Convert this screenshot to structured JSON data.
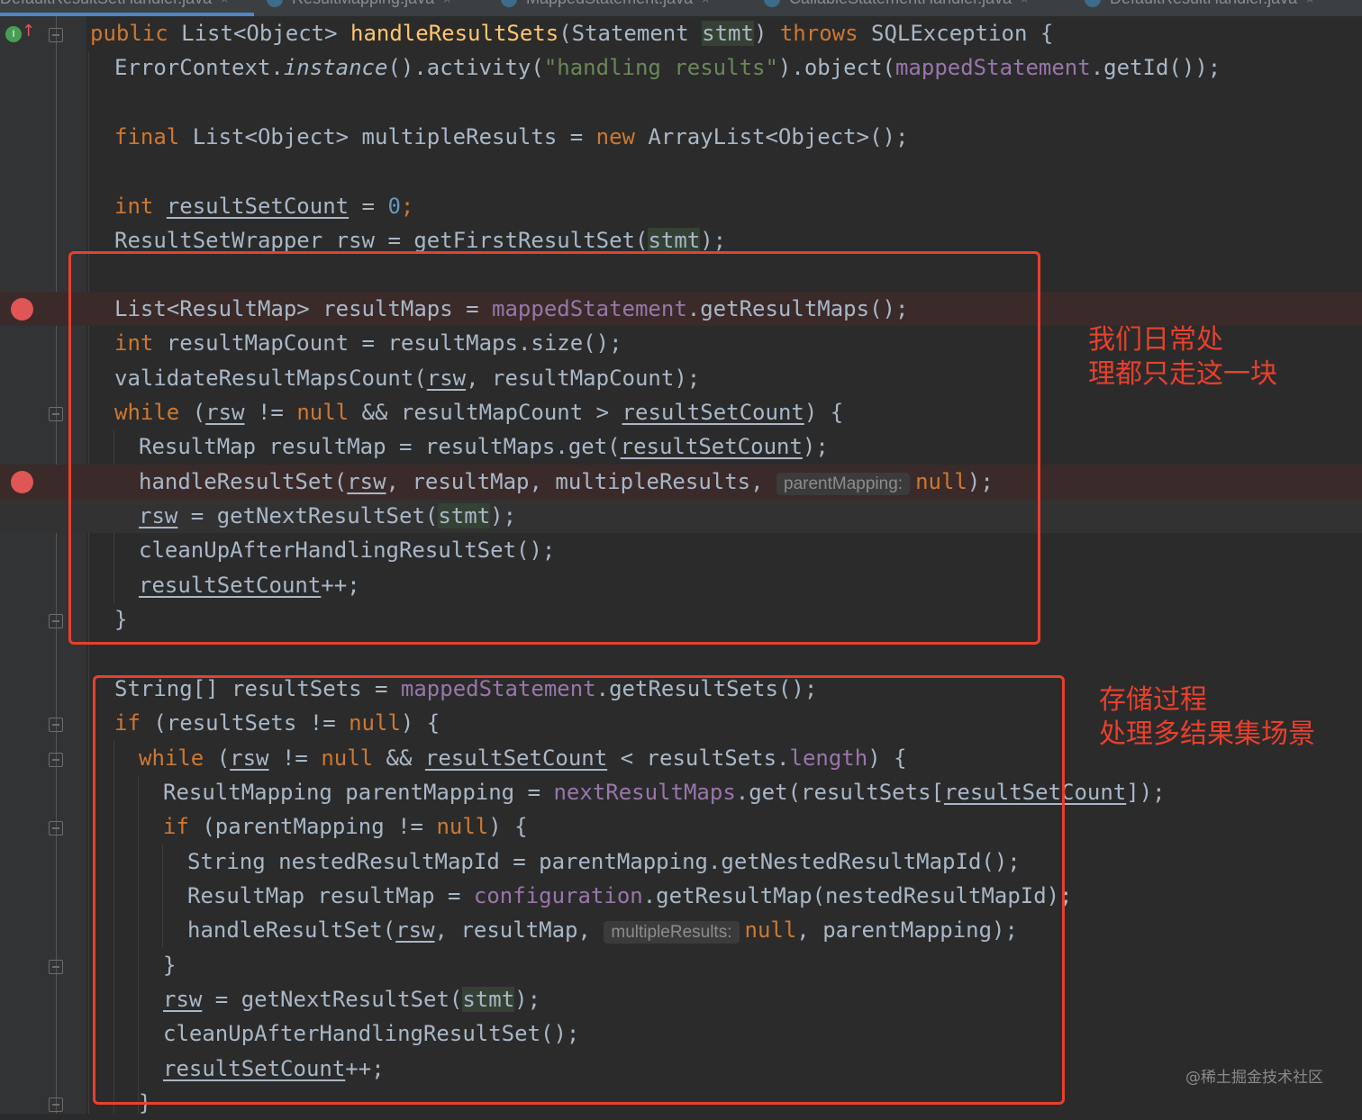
{
  "tabs": [
    {
      "label": "DefaultResultSetHandler.java",
      "close": "×"
    },
    {
      "label": "ResultMapping.java",
      "close": "×"
    },
    {
      "label": "MappedStatement.java",
      "close": "×"
    },
    {
      "label": "CallableStatementHandler.java",
      "close": "×"
    },
    {
      "label": "DefaultResultHandler.java",
      "close": "×"
    }
  ],
  "gutter": {
    "implements_icon": "override-up-arrow-icon",
    "breakpoint_color": "#e05555"
  },
  "colors": {
    "keyword": "#cc7832",
    "function": "#ffc66d",
    "string": "#6a8759",
    "number": "#6897bb",
    "field": "#9876aa",
    "text": "#a9b7c6",
    "annotation_red": "#e8402c"
  },
  "code": {
    "l1": {
      "a": "public",
      "b": " List<Object> ",
      "c": "handleResultSets",
      "d": "(Statement ",
      "e": "stmt",
      "f": ") ",
      "g": "throws",
      "h": " SQLException {"
    },
    "l2": {
      "a": "ErrorContext.",
      "b": "instance",
      "c": "().activity(",
      "d": "\"handling results\"",
      "e": ").object(",
      "f": "mappedStatement",
      "g": ".getId());"
    },
    "l4": {
      "a": "final",
      "b": " List<Object> multipleResults = ",
      "c": "new",
      "d": " ArrayList<Object>();"
    },
    "l6": {
      "a": "int",
      "b": " ",
      "c": "resultSetCount",
      "d": " = ",
      "e": "0",
      "f": ";"
    },
    "l7": {
      "a": "ResultSetWrapper ",
      "b": "rsw",
      "c": " = getFirstResultSet(",
      "d": "stmt",
      "e": ");"
    },
    "l9": {
      "a": "List<ResultMap> resultMaps = ",
      "b": "mappedStatement",
      "c": ".getResultMaps();"
    },
    "l10": {
      "a": "int",
      "b": " resultMapCount = resultMaps.size();"
    },
    "l11": {
      "a": "validateResultMapsCount(",
      "b": "rsw",
      "c": ", resultMapCount);"
    },
    "l12": {
      "a": "while",
      "b": " (",
      "c": "rsw",
      "d": " != ",
      "e": "null",
      "f": " && resultMapCount > ",
      "g": "resultSetCount",
      "h": ") {"
    },
    "l13": {
      "a": "ResultMap resultMap = resultMaps.get(",
      "b": "resultSetCount",
      "c": ");"
    },
    "l14": {
      "a": "handleResultSet(",
      "b": "rsw",
      "c": ", resultMap, multipleResults, ",
      "hint": "parentMapping:",
      "d": "null",
      "e": ");"
    },
    "l15": {
      "a": "rsw",
      "b": " = getNextResultSet(",
      "c": "stmt",
      "d": ");"
    },
    "l16": {
      "a": "cleanUpAfterHandlingResultSet();"
    },
    "l17": {
      "a": "resultSetCount",
      "b": "++;"
    },
    "l18": {
      "a": "}"
    },
    "l20": {
      "a": "String[] resultSets = ",
      "b": "mappedStatement",
      "c": ".getResultSets();"
    },
    "l21": {
      "a": "if",
      "b": " (resultSets != ",
      "c": "null",
      "d": ") {"
    },
    "l22": {
      "a": "while",
      "b": " (",
      "c": "rsw",
      "d": " != ",
      "e": "null",
      "f": " && ",
      "g": "resultSetCount",
      "h": " < resultSets.",
      "i": "length",
      "j": ") {"
    },
    "l23": {
      "a": "ResultMapping parentMapping = ",
      "b": "nextResultMaps",
      "c": ".get(resultSets[",
      "d": "resultSetCount",
      "e": "]);"
    },
    "l24": {
      "a": "if",
      "b": " (parentMapping != ",
      "c": "null",
      "d": ") {"
    },
    "l25": {
      "a": "String nestedResultMapId = parentMapping.getNestedResultMapId();"
    },
    "l26": {
      "a": "ResultMap resultMap = ",
      "b": "configuration",
      "c": ".getResultMap(nestedResultMapId);"
    },
    "l27": {
      "a": "handleResultSet(",
      "b": "rsw",
      "c": ", resultMap, ",
      "hint": "multipleResults:",
      "d": "null",
      "e": ", parentMapping);"
    },
    "l28": {
      "a": "}"
    },
    "l29": {
      "a": "rsw",
      "b": " = getNextResultSet(",
      "c": "stmt",
      "d": ");"
    },
    "l30": {
      "a": "cleanUpAfterHandlingResultSet();"
    },
    "l31": {
      "a": "resultSetCount",
      "b": "++;"
    },
    "l32": {
      "a": "}"
    }
  },
  "annotations": {
    "box1": {
      "line1": "我们日常处",
      "line2": "理都只走这一块"
    },
    "box2": {
      "line1": "存储过程",
      "line2": "处理多结果集场景"
    }
  },
  "watermark": "@稀土掘金技术社区"
}
